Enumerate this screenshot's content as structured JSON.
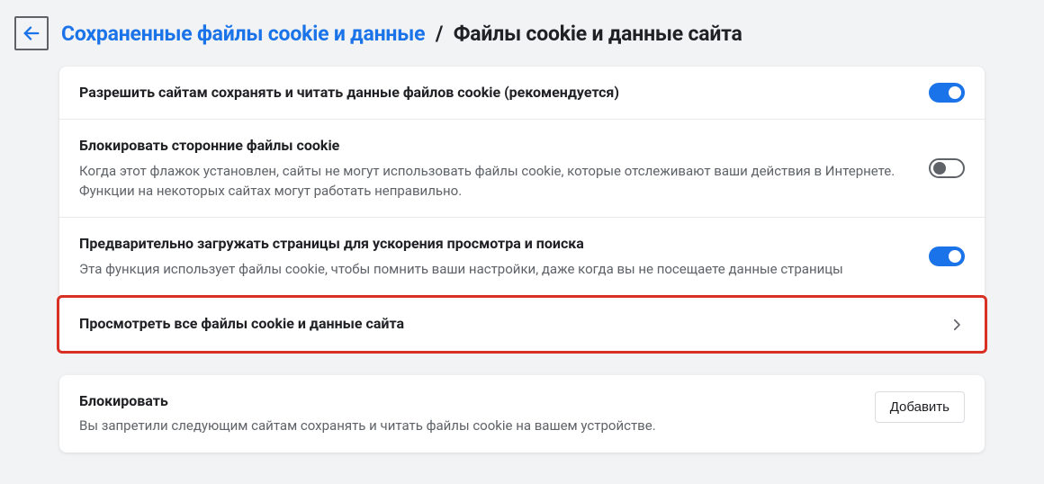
{
  "header": {
    "breadcrumb_link": "Сохраненные файлы cookie и данные",
    "breadcrumb_sep": "/",
    "breadcrumb_current": "Файлы cookie и данные сайта"
  },
  "settings": {
    "allow": {
      "title": "Разрешить сайтам сохранять и читать данные файлов cookie (рекомендуется)",
      "enabled": true
    },
    "block_third_party": {
      "title": "Блокировать сторонние файлы cookie",
      "desc": "Когда этот флажок установлен, сайты не могут использовать файлы cookie, которые отслеживают ваши действия в Интернете. Функции на некоторых сайтах могут работать неправильно.",
      "enabled": false
    },
    "preload": {
      "title": "Предварительно загружать страницы для ускорения просмотра и поиска",
      "desc": "Эта функция использует файлы cookie, чтобы помнить ваши настройки, даже когда вы не посещаете данные страницы",
      "enabled": true
    },
    "see_all": {
      "title": "Просмотреть все файлы cookie и данные сайта"
    }
  },
  "block_section": {
    "title": "Блокировать",
    "desc": "Вы запретили следующим сайтам сохранять и читать файлы cookie на вашем устройстве.",
    "add_label": "Добавить"
  }
}
